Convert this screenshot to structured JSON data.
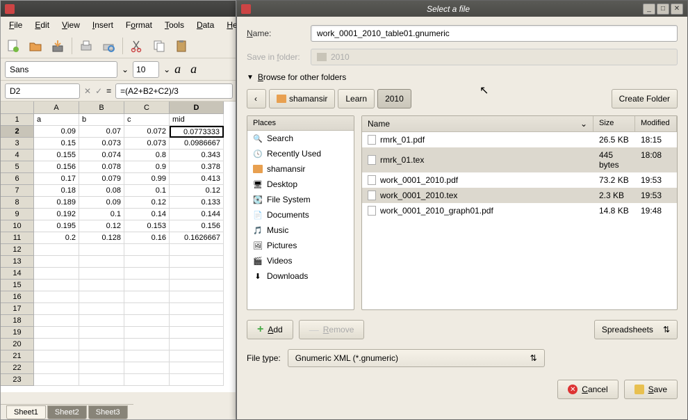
{
  "menubar": {
    "file": "File",
    "edit": "Edit",
    "view": "View",
    "insert": "Insert",
    "format": "Format",
    "tools": "Tools",
    "data": "Data",
    "help": "Help"
  },
  "fontbar": {
    "font": "Sans",
    "size": "10"
  },
  "cellbar": {
    "ref": "D2",
    "formula": "=(A2+B2+C2)/3",
    "eq": "="
  },
  "columns": [
    "A",
    "B",
    "C",
    "D"
  ],
  "headers": {
    "a": "a",
    "b": "b",
    "c": "c",
    "d": "mid"
  },
  "rows": [
    {
      "n": 2,
      "a": "0.09",
      "b": "0.07",
      "c": "0.072",
      "d": "0.0773333"
    },
    {
      "n": 3,
      "a": "0.15",
      "b": "0.073",
      "c": "0.073",
      "d": "0.0986667"
    },
    {
      "n": 4,
      "a": "0.155",
      "b": "0.074",
      "c": "0.8",
      "d": "0.343"
    },
    {
      "n": 5,
      "a": "0.156",
      "b": "0.078",
      "c": "0.9",
      "d": "0.378"
    },
    {
      "n": 6,
      "a": "0.17",
      "b": "0.079",
      "c": "0.99",
      "d": "0.413"
    },
    {
      "n": 7,
      "a": "0.18",
      "b": "0.08",
      "c": "0.1",
      "d": "0.12"
    },
    {
      "n": 8,
      "a": "0.189",
      "b": "0.09",
      "c": "0.12",
      "d": "0.133"
    },
    {
      "n": 9,
      "a": "0.192",
      "b": "0.1",
      "c": "0.14",
      "d": "0.144"
    },
    {
      "n": 10,
      "a": "0.195",
      "b": "0.12",
      "c": "0.153",
      "d": "0.156"
    },
    {
      "n": 11,
      "a": "0.2",
      "b": "0.128",
      "c": "0.16",
      "d": "0.1626667"
    }
  ],
  "sheets": {
    "s1": "Sheet1",
    "s2": "Sheet2",
    "s3": "Sheet3"
  },
  "dialog": {
    "title": "Select a file",
    "name_label": "Name:",
    "name_value": "work_0001_2010_table01.gnumeric",
    "savein_label": "Save in folder:",
    "savein_value": "2010",
    "browse_label": "Browse for other folders",
    "path": {
      "back": "‹",
      "home": "shamansir",
      "p1": "Learn",
      "p2": "2010"
    },
    "create_folder": "Create Folder",
    "places_header": "Places",
    "places": {
      "search": "Search",
      "recent": "Recently Used",
      "home": "shamansir",
      "desktop": "Desktop",
      "fs": "File System",
      "docs": "Documents",
      "music": "Music",
      "pics": "Pictures",
      "videos": "Videos",
      "downloads": "Downloads"
    },
    "fl_headers": {
      "name": "Name",
      "size": "Size",
      "modified": "Modified"
    },
    "files": [
      {
        "name": "rmrk_01.pdf",
        "size": "26.5 KB",
        "mod": "18:15"
      },
      {
        "name": "rmrk_01.tex",
        "size": "445 bytes",
        "mod": "18:08",
        "sel": true
      },
      {
        "name": "work_0001_2010.pdf",
        "size": "73.2 KB",
        "mod": "19:53"
      },
      {
        "name": "work_0001_2010.tex",
        "size": "2.3 KB",
        "mod": "19:53",
        "sel": true
      },
      {
        "name": "work_0001_2010_graph01.pdf",
        "size": "14.8 KB",
        "mod": "19:48"
      }
    ],
    "add": "Add",
    "remove": "Remove",
    "spreadsheets": "Spreadsheets",
    "filetype_label": "File type:",
    "filetype_value": "Gnumeric XML (*.gnumeric)",
    "cancel": "Cancel",
    "save": "Save"
  }
}
